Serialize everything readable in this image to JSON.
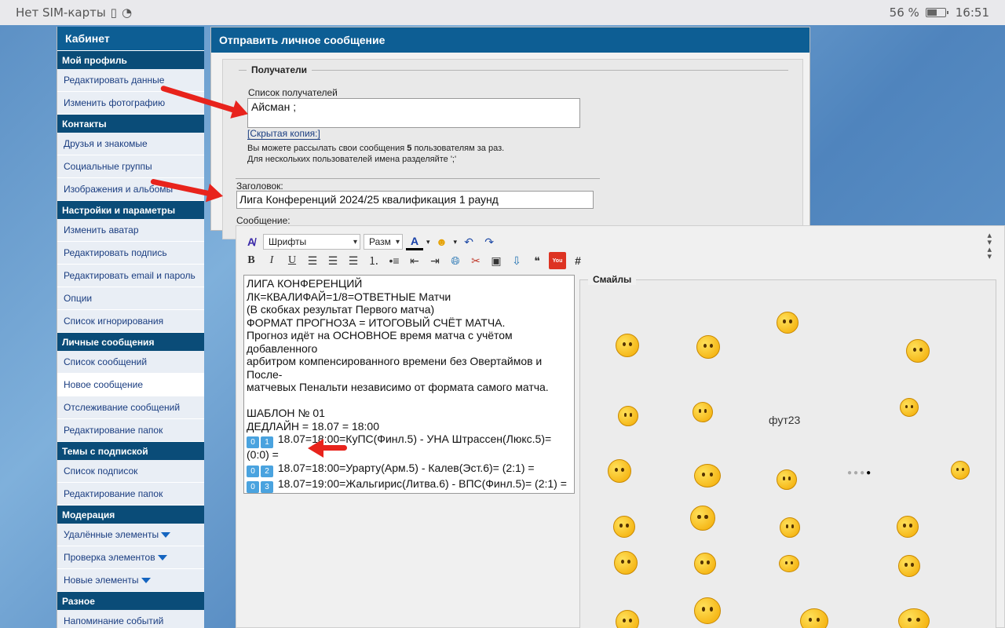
{
  "status_bar": {
    "carrier": "Нет SIM-карты",
    "battery": "56 %",
    "time": "16:51"
  },
  "sidebar": {
    "title": "Кабинет",
    "sections": [
      {
        "header": "Мой профиль",
        "items": [
          "Редактировать данные",
          "Изменить фотографию"
        ]
      },
      {
        "header": "Контакты",
        "items": [
          "Друзья и знакомые",
          "Социальные группы",
          "Изображения и альбомы"
        ]
      },
      {
        "header": "Настройки и параметры",
        "items": [
          "Изменить аватар",
          "Редактировать подпись",
          "Редактировать email и пароль",
          "Опции",
          "Список игнорирования"
        ]
      },
      {
        "header": "Личные сообщения",
        "items": [
          "Список сообщений",
          "Новое сообщение",
          "Отслеживание сообщений",
          "Редактирование папок"
        ]
      },
      {
        "header": "Темы с подпиской",
        "items": [
          "Список подписок",
          "Редактирование папок"
        ]
      },
      {
        "header": "Модерация",
        "items": [
          "Удалённые элементы",
          "Проверка элементов",
          "Новые элементы"
        ]
      },
      {
        "header": "Разное",
        "items": [
          "Напоминание событий"
        ]
      }
    ]
  },
  "main": {
    "title": "Отправить личное сообщение",
    "recipients_legend": "Получатели",
    "recipients_label": "Список получателей",
    "recipients_value": "Айсман ;",
    "bcc_link": "[Скрытая копия:]",
    "hint_line1_pre": "Вы можете рассылать свои сообщения ",
    "hint_line1_num": "5",
    "hint_line1_post": " пользователям за раз.",
    "hint_line2": "Для нескольких пользователей имена разделяйте ';'",
    "subject_label": "Заголовок:",
    "subject_value": "Лига Конференций 2024/25 квалификация 1 раунд",
    "message_label": "Сообщение:"
  },
  "editor": {
    "font_select": "Шрифты",
    "size_select": "Разм",
    "message_lines": [
      "ЛИГА КОНФЕРЕНЦИЙ",
      "ЛК=КВАЛИФАЙ=1/8=ОТВЕТНЫЕ Матчи",
      "(В скобках результат Первого матча)",
      "ФОРМАТ ПРОГНОЗА = ИТОГОВЫЙ СЧЁТ МАТЧА.",
      "Прогноз идёт на ОСНОВНОЕ время матча с учётом добавленного",
      "арбитром компенсированного времени без Овертаймов и После-",
      "матчевых Пенальти независимо от формата самого матча.",
      "",
      "ШАБЛОН № 01",
      "ДЕДЛАЙН = 18.07 = 18:00"
    ],
    "match_lines": [
      {
        "num": [
          "0",
          "1"
        ],
        "text": "18.07=18:00=КуПС(Финл.5) - УНА Штрассен(Люкс.5)= (0:0) ="
      },
      {
        "num": [
          "0",
          "2"
        ],
        "text": "18.07=18:00=Урарту(Арм.5) - Калев(Эст.6)= (2:1) ="
      },
      {
        "num": [
          "0",
          "3"
        ],
        "text": "18.07=19:00=Жальгирис(Литва.6) - ВПС(Финл.5)= (2:1) ="
      }
    ],
    "smilies_legend": "Смайлы",
    "broken_image_alt": "фут23"
  }
}
